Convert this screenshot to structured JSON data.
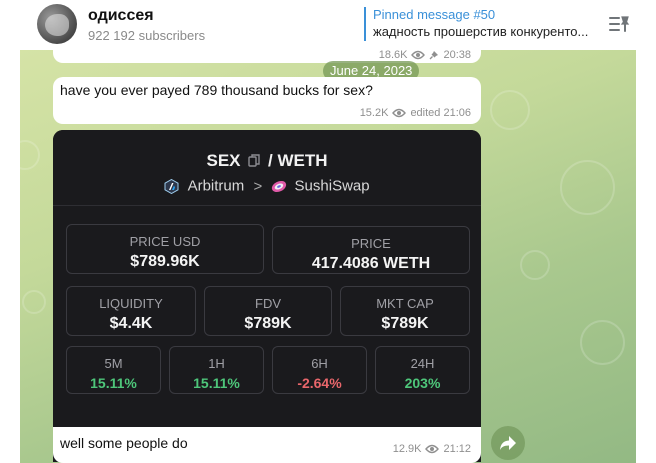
{
  "header": {
    "title": "одиссея",
    "subscribers": "922 192 subscribers",
    "pinned_title": "Pinned message #50",
    "pinned_text": "жадность прошерстив конкуренто..."
  },
  "messages": {
    "prev": {
      "views": "18.6K",
      "time": "20:38"
    },
    "date": "June 24, 2023",
    "question": {
      "text": "have you ever payed 789 thousand bucks for sex?",
      "views": "15.2K",
      "edited": "edited 21:06"
    },
    "card": {
      "pair_base": "SEX",
      "pair_sep": "/",
      "pair_quote": "WETH",
      "chain": "Arbitrum",
      "chain_sep": ">",
      "dex": "SushiSwap",
      "price_usd_label": "PRICE USD",
      "price_usd": "$789.96K",
      "price_label": "PRICE",
      "price": "417.4086 WETH",
      "liquidity_label": "LIQUIDITY",
      "liquidity": "$4.4K",
      "fdv_label": "FDV",
      "fdv": "$789K",
      "mktcap_label": "MKT CAP",
      "mktcap": "$789K",
      "changes": [
        {
          "label": "5M",
          "value": "15.11%"
        },
        {
          "label": "1H",
          "value": "15.11%"
        },
        {
          "label": "6H",
          "value": "-2.64%"
        },
        {
          "label": "24H",
          "value": "203%"
        }
      ]
    },
    "answer": {
      "text": "well some people do",
      "views": "12.9K",
      "time": "21:12"
    }
  }
}
